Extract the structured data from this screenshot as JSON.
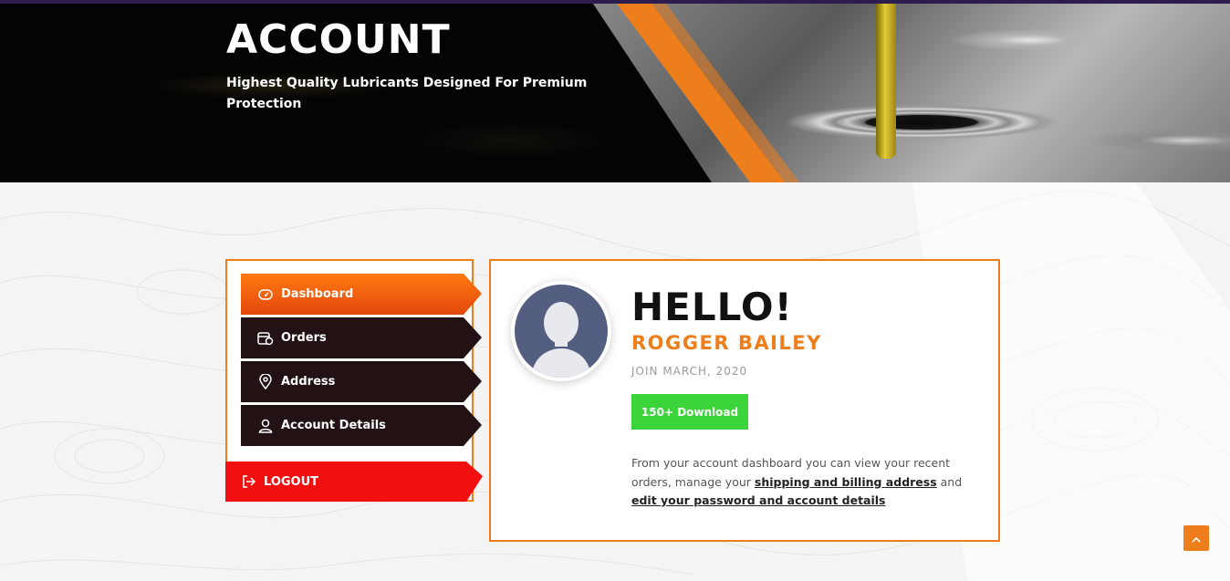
{
  "hero": {
    "title": "ACCOUNT",
    "subtitle": "Highest Quality Lubricants Designed For Premium Protection"
  },
  "sidebar": {
    "items": [
      {
        "label": "Dashboard",
        "icon": "dashboard-icon",
        "active": true
      },
      {
        "label": "Orders",
        "icon": "orders-icon",
        "active": false
      },
      {
        "label": "Address",
        "icon": "location-pin-icon",
        "active": false
      },
      {
        "label": "Account Details",
        "icon": "user-icon",
        "active": false
      }
    ],
    "logout_label": "LOGOUT"
  },
  "profile": {
    "greeting": "HELLO!",
    "name": "ROGGER BAILEY",
    "joined": "JOIN MARCH, 2020",
    "download_label": "150+ Download"
  },
  "description": {
    "text1": "From your account dashboard you can view your recent orders, manage your ",
    "link1": "shipping and billing address",
    "text2": " and ",
    "link2": "edit your password and account details"
  },
  "colors": {
    "accent": "#ee7d1b",
    "nav_dark": "#231214",
    "logout": "#f10f0f",
    "download": "#3bd43b"
  }
}
